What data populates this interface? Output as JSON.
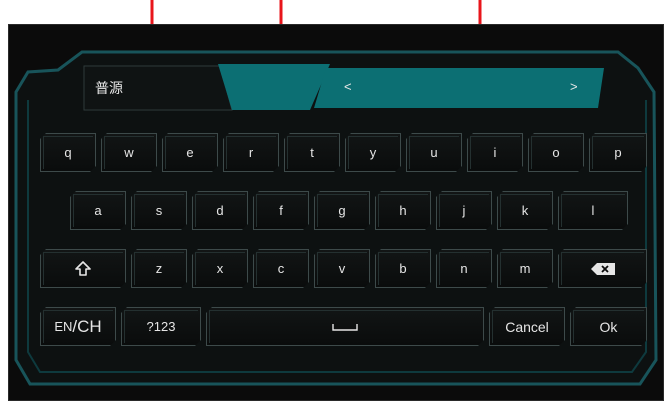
{
  "input": {
    "text": "普源"
  },
  "candidate_bar": {
    "prev": "<",
    "next": ">"
  },
  "keys": {
    "row1": [
      "q",
      "w",
      "e",
      "r",
      "t",
      "y",
      "u",
      "i",
      "o",
      "p"
    ],
    "row2": [
      "a",
      "s",
      "d",
      "f",
      "g",
      "h",
      "j",
      "k",
      "l"
    ],
    "row3": [
      "z",
      "x",
      "c",
      "v",
      "b",
      "n",
      "m"
    ],
    "lang_en": "EN",
    "lang_sep": "/",
    "lang_ch": "CH",
    "numeric": "?123",
    "cancel": "Cancel",
    "ok": "Ok"
  },
  "colors": {
    "accent": "#0c6f73",
    "arrow": "#e8151b",
    "frame_outer": "#18545a",
    "background": "#0b0b0b"
  },
  "icons": {
    "shift": "shift-icon",
    "backspace": "backspace-icon",
    "space": "space-icon"
  }
}
